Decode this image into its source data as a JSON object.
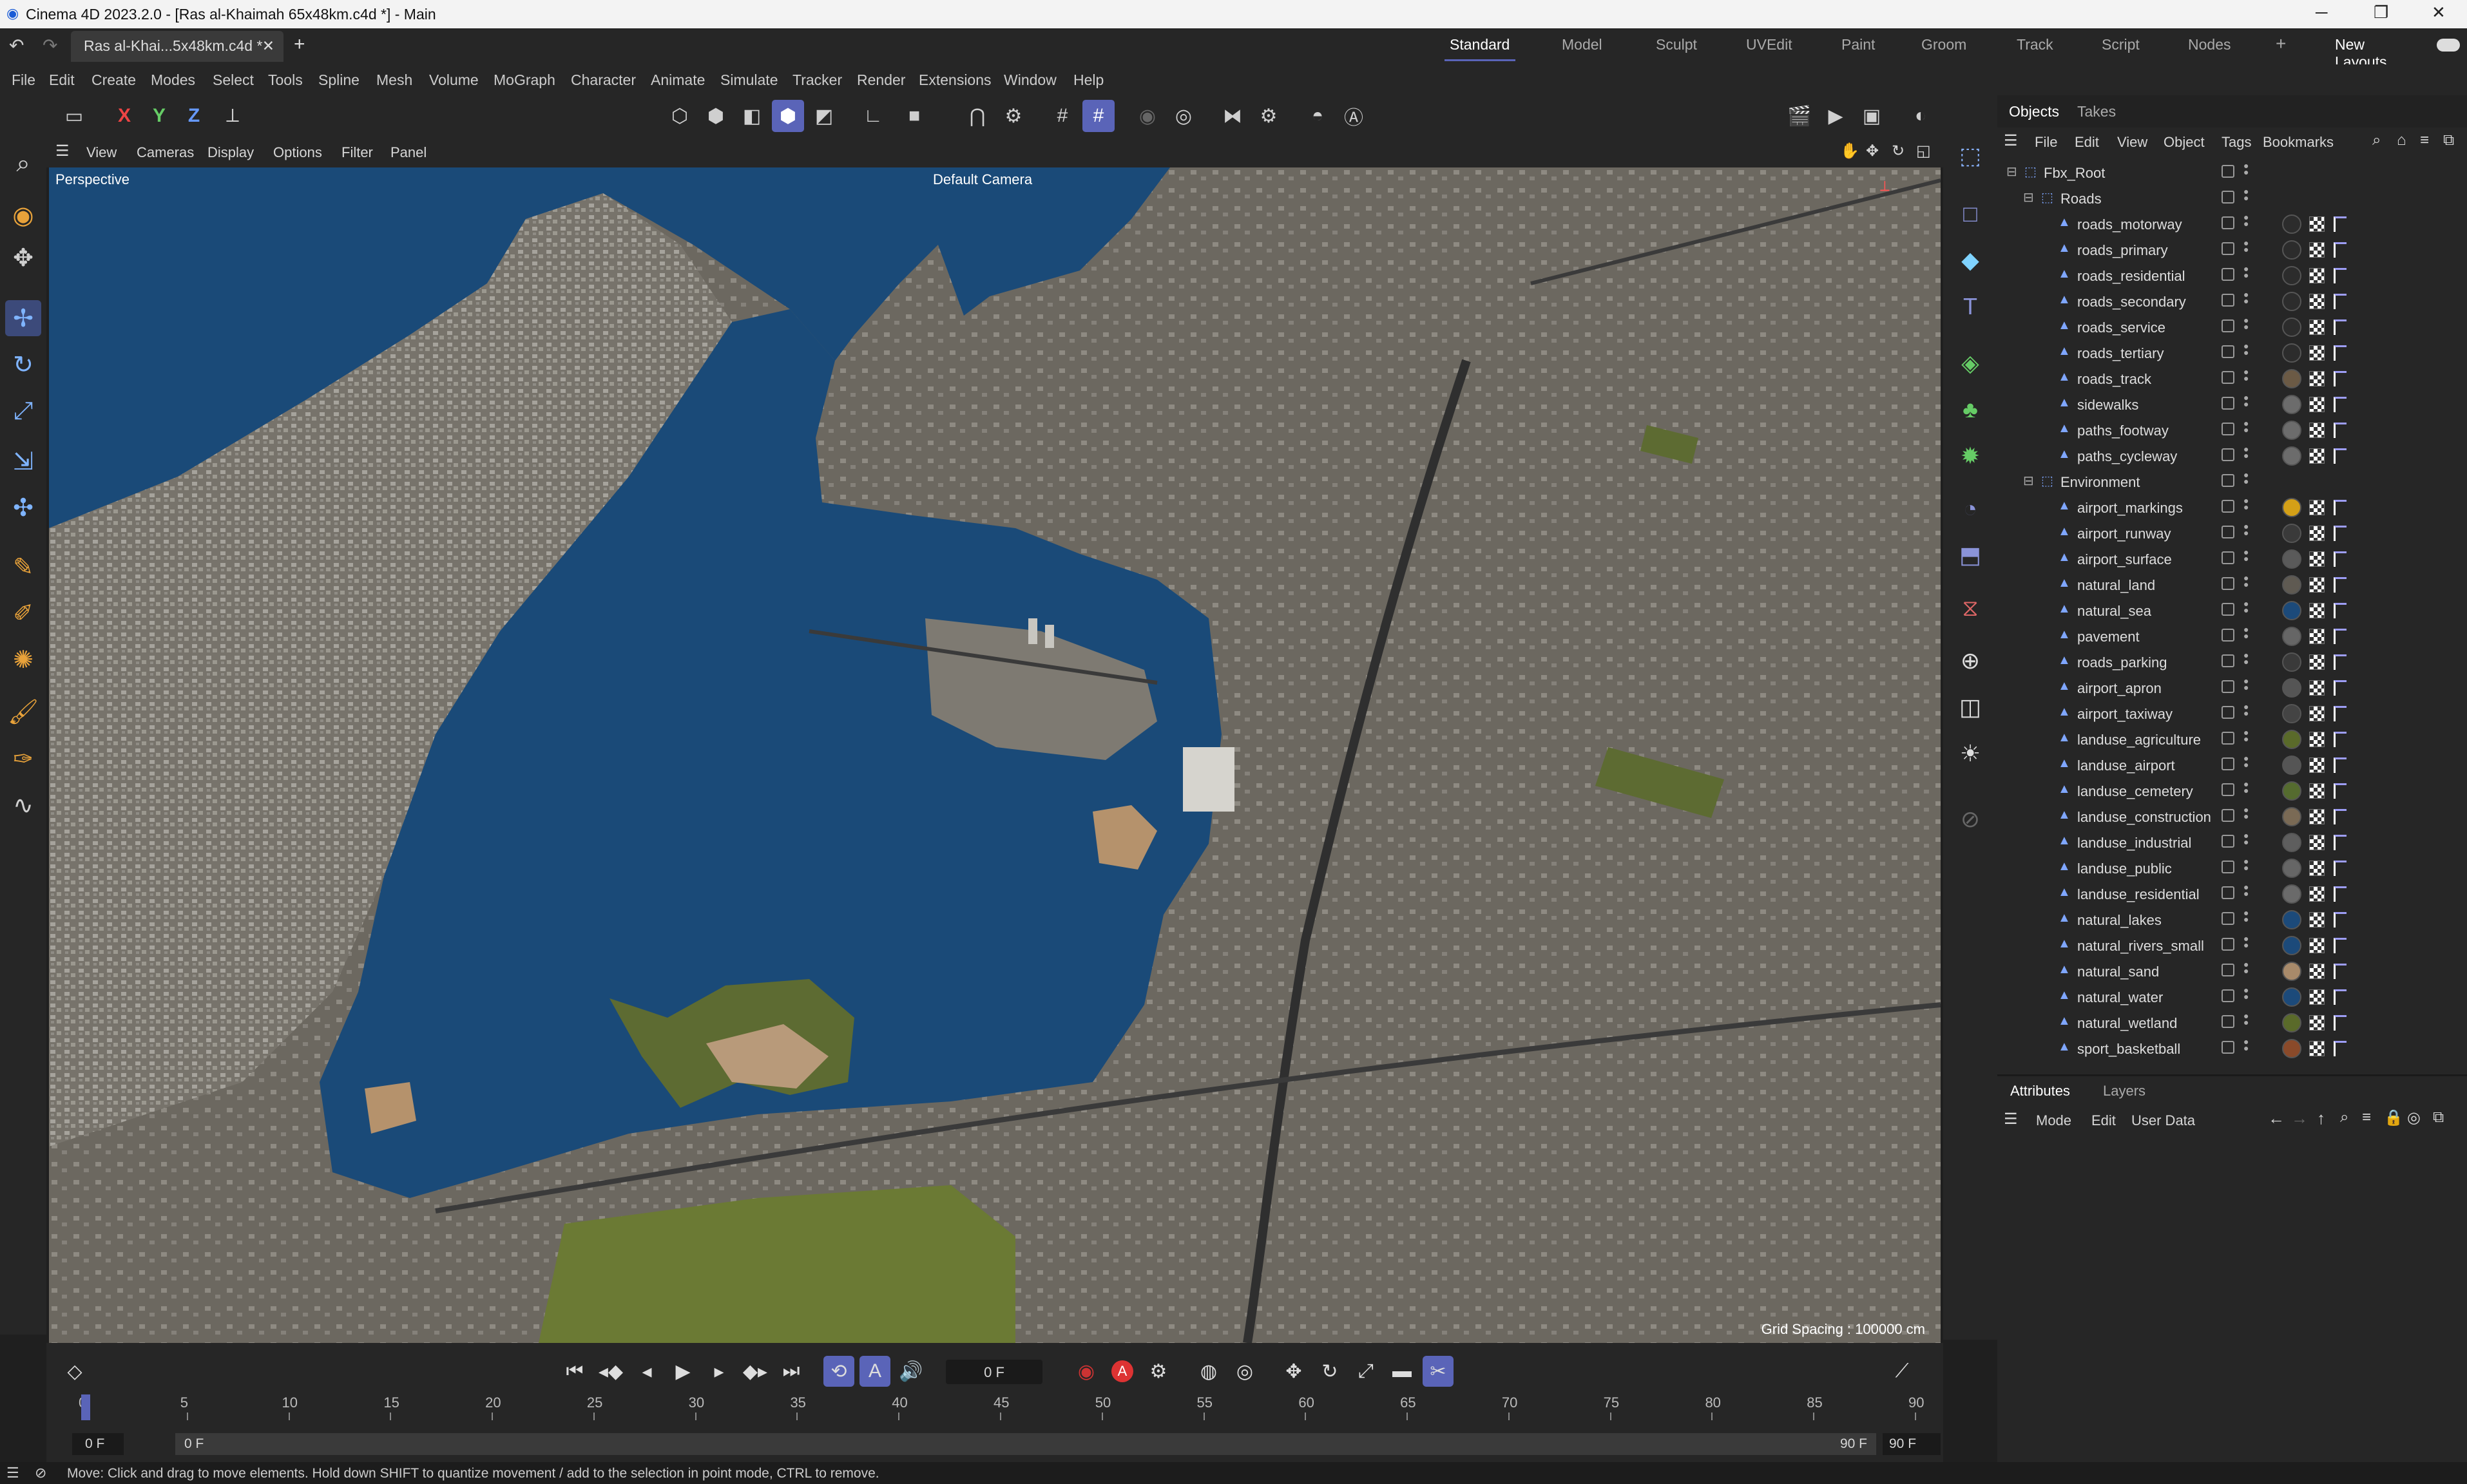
{
  "window": {
    "title": "Cinema 4D 2023.2.0 - [Ras al-Khaimah 65x48km.c4d *] - Main"
  },
  "doc_tab": {
    "label": "Ras al-Khai...5x48km.c4d *"
  },
  "layouts": {
    "items": [
      "Standard",
      "Model",
      "Sculpt",
      "UVEdit",
      "Paint",
      "Groom",
      "Track",
      "Script",
      "Nodes"
    ],
    "active": "Standard",
    "new_layouts": "New Layouts"
  },
  "menu": [
    "File",
    "Edit",
    "Create",
    "Modes",
    "Select",
    "Tools",
    "Spline",
    "Mesh",
    "Volume",
    "MoGraph",
    "Character",
    "Animate",
    "Simulate",
    "Tracker",
    "Render",
    "Extensions",
    "Window",
    "Help"
  ],
  "axes": {
    "x": "X",
    "y": "Y",
    "z": "Z"
  },
  "viewport_menu": [
    "View",
    "Cameras",
    "Display",
    "Options",
    "Filter",
    "Panel"
  ],
  "viewport": {
    "projection": "Perspective",
    "camera": "Default Camera",
    "grid_spacing": "Grid Spacing : 100000 cm"
  },
  "obj_tabs": {
    "objects": "Objects",
    "takes": "Takes"
  },
  "obj_menu": [
    "File",
    "Edit",
    "View",
    "Object",
    "Tags",
    "Bookmarks"
  ],
  "objects": [
    {
      "name": "Fbx_Root",
      "level": 0,
      "type": "null",
      "mat": ""
    },
    {
      "name": "Roads",
      "level": 1,
      "type": "null",
      "mat": ""
    },
    {
      "name": "roads_motorway",
      "level": 2,
      "type": "poly",
      "mat": "#2c2c2c"
    },
    {
      "name": "roads_primary",
      "level": 2,
      "type": "poly",
      "mat": "#2c2c2c"
    },
    {
      "name": "roads_residential",
      "level": 2,
      "type": "poly",
      "mat": "#2c2c2c"
    },
    {
      "name": "roads_secondary",
      "level": 2,
      "type": "poly",
      "mat": "#2c2c2c"
    },
    {
      "name": "roads_service",
      "level": 2,
      "type": "poly",
      "mat": "#2c2c2c"
    },
    {
      "name": "roads_tertiary",
      "level": 2,
      "type": "poly",
      "mat": "#2c2c2c"
    },
    {
      "name": "roads_track",
      "level": 2,
      "type": "poly",
      "mat": "#6b5a45"
    },
    {
      "name": "sidewalks",
      "level": 2,
      "type": "poly",
      "mat": "#6c6c6c"
    },
    {
      "name": "paths_footway",
      "level": 2,
      "type": "poly",
      "mat": "#6c6c6c"
    },
    {
      "name": "paths_cycleway",
      "level": 2,
      "type": "poly",
      "mat": "#6c6c6c"
    },
    {
      "name": "Environment",
      "level": 1,
      "type": "null",
      "mat": ""
    },
    {
      "name": "airport_markings",
      "level": 2,
      "type": "poly",
      "mat": "#d4a017"
    },
    {
      "name": "airport_runway",
      "level": 2,
      "type": "poly",
      "mat": "#3a3a3a"
    },
    {
      "name": "airport_surface",
      "level": 2,
      "type": "poly",
      "mat": "#5a5a5a"
    },
    {
      "name": "natural_land",
      "level": 2,
      "type": "poly",
      "mat": "#5f5a52"
    },
    {
      "name": "natural_sea",
      "level": 2,
      "type": "poly",
      "mat": "#1c4a7a"
    },
    {
      "name": "pavement",
      "level": 2,
      "type": "poly",
      "mat": "#666"
    },
    {
      "name": "roads_parking",
      "level": 2,
      "type": "poly",
      "mat": "#3a3a3a"
    },
    {
      "name": "airport_apron",
      "level": 2,
      "type": "poly",
      "mat": "#555"
    },
    {
      "name": "airport_taxiway",
      "level": 2,
      "type": "poly",
      "mat": "#444"
    },
    {
      "name": "landuse_agriculture",
      "level": 2,
      "type": "poly",
      "mat": "#5a6a2a"
    },
    {
      "name": "landuse_airport",
      "level": 2,
      "type": "poly",
      "mat": "#555"
    },
    {
      "name": "landuse_cemetery",
      "level": 2,
      "type": "poly",
      "mat": "#556b2f"
    },
    {
      "name": "landuse_construction",
      "level": 2,
      "type": "poly",
      "mat": "#7a6a55"
    },
    {
      "name": "landuse_industrial",
      "level": 2,
      "type": "poly",
      "mat": "#5e5e5e"
    },
    {
      "name": "landuse_public",
      "level": 2,
      "type": "poly",
      "mat": "#666"
    },
    {
      "name": "landuse_residential",
      "level": 2,
      "type": "poly",
      "mat": "#6a6a6a"
    },
    {
      "name": "natural_lakes",
      "level": 2,
      "type": "poly",
      "mat": "#1c4a7a"
    },
    {
      "name": "natural_rivers_small",
      "level": 2,
      "type": "poly",
      "mat": "#1c4a7a"
    },
    {
      "name": "natural_sand",
      "level": 2,
      "type": "poly",
      "mat": "#a88a6a"
    },
    {
      "name": "natural_water",
      "level": 2,
      "type": "poly",
      "mat": "#1c4a7a"
    },
    {
      "name": "natural_wetland",
      "level": 2,
      "type": "poly",
      "mat": "#5a6a2a"
    },
    {
      "name": "sport_basketball",
      "level": 2,
      "type": "poly",
      "mat": "#8a4a2a"
    }
  ],
  "attr_tabs": {
    "attributes": "Attributes",
    "layers": "Layers"
  },
  "attr_menu": [
    "Mode",
    "Edit",
    "User Data"
  ],
  "timeline": {
    "current_frame": "0 F",
    "ticks": [
      "0",
      "5",
      "10",
      "15",
      "20",
      "25",
      "30",
      "35",
      "40",
      "45",
      "50",
      "55",
      "60",
      "65",
      "70",
      "75",
      "80",
      "85",
      "90"
    ],
    "start": "0 F",
    "start2": "0 F",
    "end": "90 F",
    "end2": "90 F"
  },
  "status": "Move: Click and drag to move elements. Hold down SHIFT to quantize movement / add to the selection in point mode, CTRL to remove.",
  "colors": {
    "accent": "#5a64b8",
    "sea": "#1a4a78",
    "land": "#6e6a62"
  }
}
